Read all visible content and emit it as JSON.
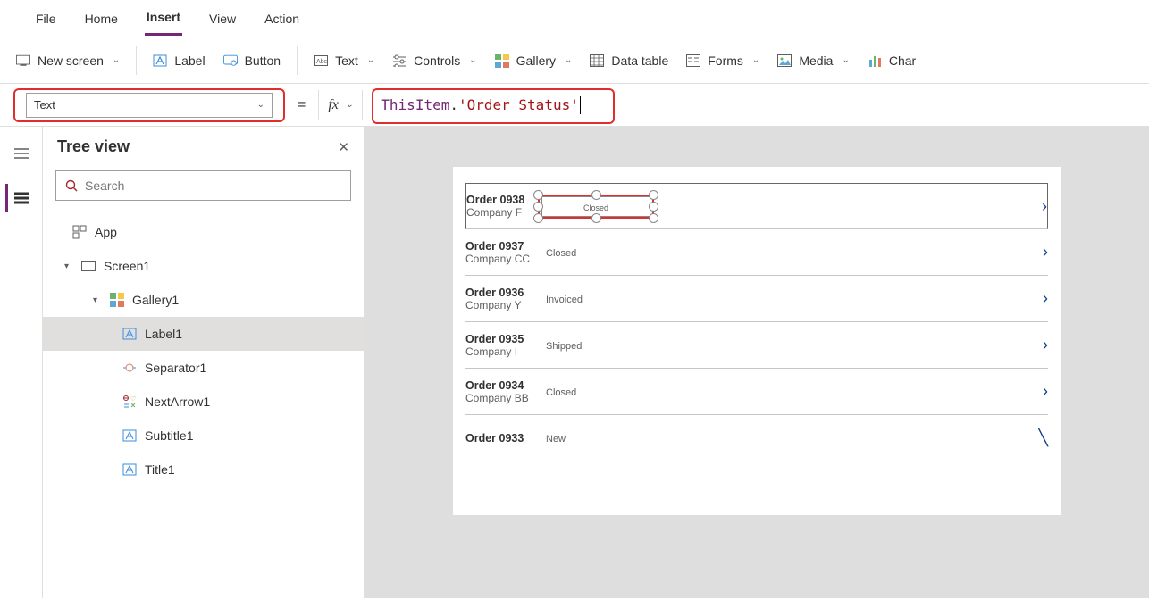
{
  "menu": {
    "file": "File",
    "home": "Home",
    "insert": "Insert",
    "view": "View",
    "action": "Action"
  },
  "ribbon": {
    "new_screen": "New screen",
    "label": "Label",
    "button": "Button",
    "text": "Text",
    "controls": "Controls",
    "gallery": "Gallery",
    "data_table": "Data table",
    "forms": "Forms",
    "media": "Media",
    "chart": "Char"
  },
  "property_selector": "Text",
  "formula_parts": {
    "object": "ThisItem",
    "dot": ".",
    "field": "'Order Status'"
  },
  "tree": {
    "title": "Tree view",
    "search_placeholder": "Search",
    "app": "App",
    "screen": "Screen1",
    "gallery": "Gallery1",
    "items": {
      "label1": "Label1",
      "separator": "Separator1",
      "nextarrow": "NextArrow1",
      "subtitle": "Subtitle1",
      "title": "Title1"
    }
  },
  "gallery_rows": [
    {
      "title": "Order 0938",
      "subtitle": "Company F",
      "status": "Closed"
    },
    {
      "title": "Order 0937",
      "subtitle": "Company CC",
      "status": "Closed"
    },
    {
      "title": "Order 0936",
      "subtitle": "Company Y",
      "status": "Invoiced"
    },
    {
      "title": "Order 0935",
      "subtitle": "Company I",
      "status": "Shipped"
    },
    {
      "title": "Order 0934",
      "subtitle": "Company BB",
      "status": "Closed"
    },
    {
      "title": "Order 0933",
      "subtitle": "",
      "status": "New"
    }
  ]
}
